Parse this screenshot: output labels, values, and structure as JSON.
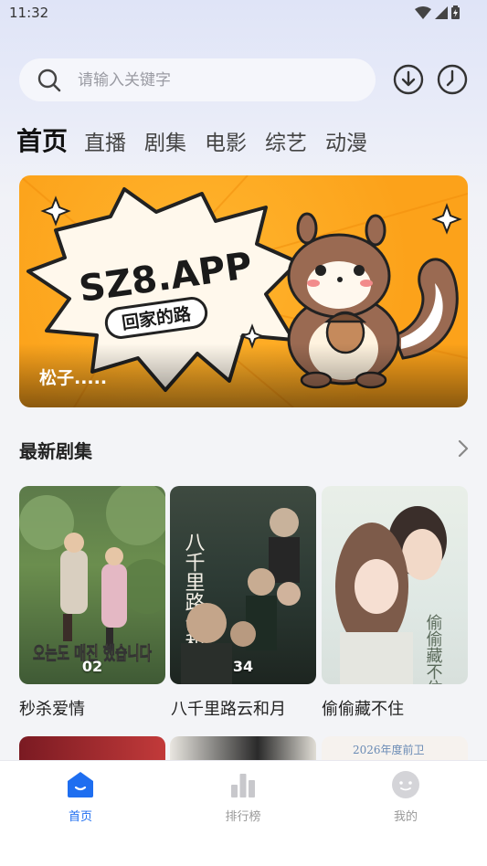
{
  "status_bar": {
    "time": "11:32"
  },
  "search": {
    "placeholder": "请输入关键字"
  },
  "nav_tabs": [
    "首页",
    "直播",
    "剧集",
    "电影",
    "综艺",
    "动漫"
  ],
  "banner": {
    "headline": "SZ8.APP",
    "subtitle": "回家的路",
    "caption": "松子....."
  },
  "section": {
    "title": "最新剧集"
  },
  "posters": [
    {
      "title": "秒杀爱情",
      "badge": "02",
      "art_text": "오는도 매진 했습니다"
    },
    {
      "title": "八千里路云和月",
      "badge": "34",
      "art_text": "八千里路云和月"
    },
    {
      "title": "偷偷藏不住",
      "badge": "",
      "art_text": "偷偷藏不住"
    }
  ],
  "partial_row": {
    "third_text": "2026年度前卫"
  },
  "tabbar": [
    {
      "label": "首页",
      "icon": "home-icon",
      "active": true
    },
    {
      "label": "排行榜",
      "icon": "ranking-icon",
      "active": false
    },
    {
      "label": "我的",
      "icon": "profile-icon",
      "active": false
    }
  ],
  "colors": {
    "accent": "#1e6ef0",
    "banner_bg": "#fca21a"
  }
}
